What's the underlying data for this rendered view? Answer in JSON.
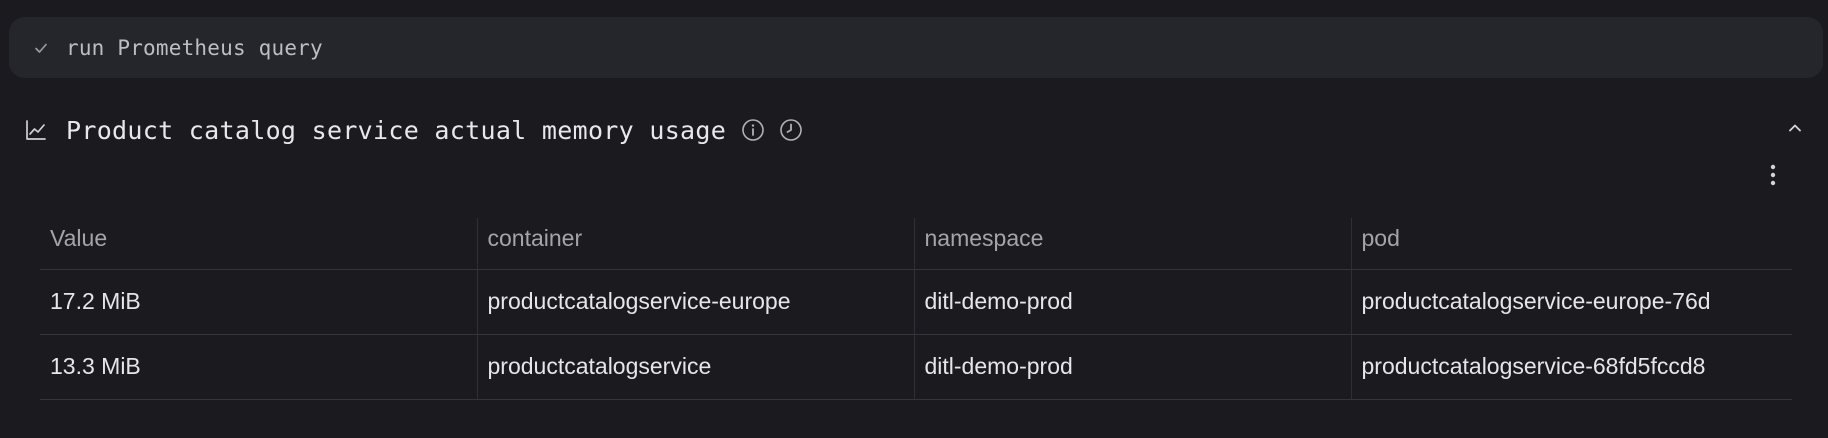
{
  "step": {
    "label": "run Prometheus query",
    "status_icon": "check-icon"
  },
  "panel": {
    "title": "Product catalog service actual memory usage",
    "icons": [
      "line-chart-icon",
      "info-icon",
      "clock-icon",
      "chevron-up-icon",
      "more-vertical-icon"
    ]
  },
  "table": {
    "headers": [
      "Value",
      "container",
      "namespace",
      "pod"
    ],
    "rows": [
      [
        "17.2 MiB",
        "productcatalogservice-europe",
        "ditl-demo-prod",
        "productcatalogservice-europe-76d"
      ],
      [
        "13.3 MiB",
        "productcatalogservice",
        "ditl-demo-prod",
        "productcatalogservice-68fd5fccd8"
      ]
    ]
  },
  "colors": {
    "background": "#1b1b1f",
    "step_bar": "#25262b",
    "text": "#e6e6e9",
    "muted": "#a4a4aa",
    "border": "#34353b"
  }
}
